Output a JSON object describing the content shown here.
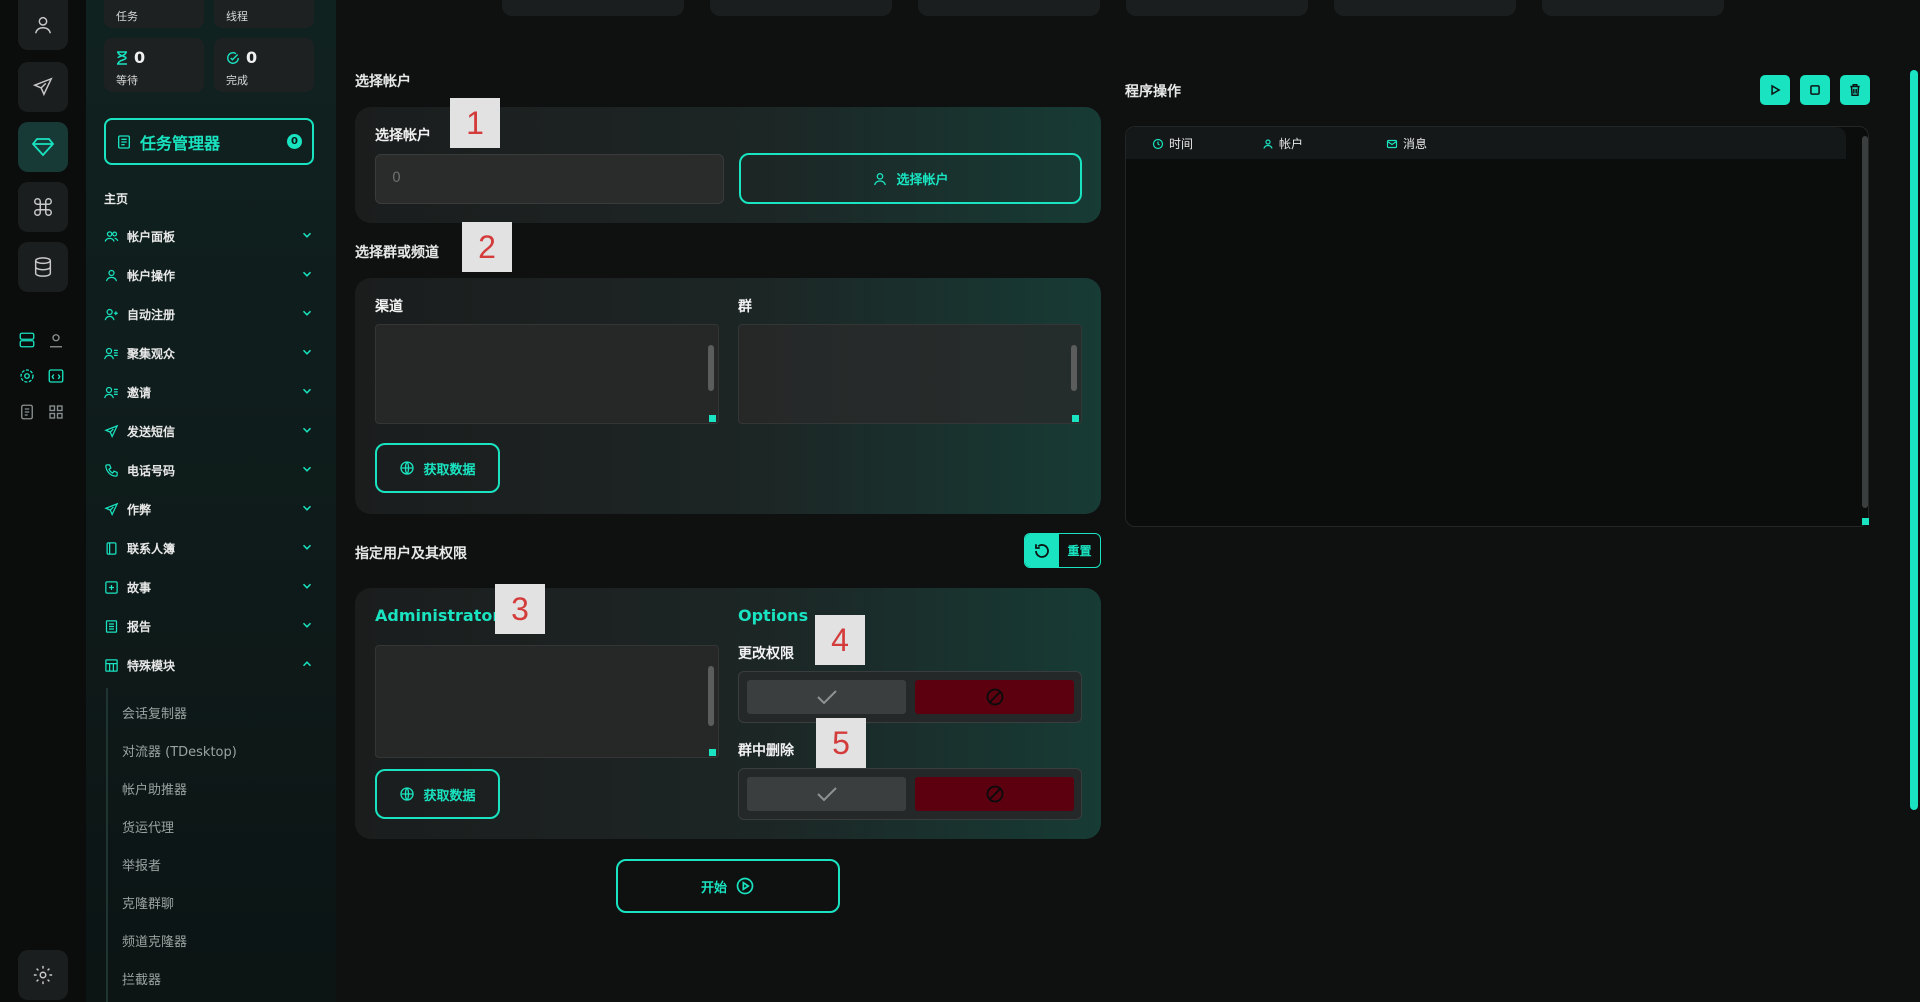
{
  "sidebar": {
    "stats": [
      {
        "label": "任务"
      },
      {
        "label": "线程"
      },
      {
        "value": "0",
        "label": "等待",
        "icon": "hourglass-icon"
      },
      {
        "value": "0",
        "label": "完成",
        "icon": "check-circle-icon"
      }
    ],
    "task_manager": {
      "label": "任务管理器",
      "badge": "0"
    },
    "section_label": "主页",
    "items": [
      {
        "label": "帐户面板",
        "icon": "users-icon"
      },
      {
        "label": "帐户操作",
        "icon": "user-icon"
      },
      {
        "label": "自动注册",
        "icon": "user-plus-icon"
      },
      {
        "label": "聚集观众",
        "icon": "user-list-icon"
      },
      {
        "label": "邀请",
        "icon": "user-list-icon"
      },
      {
        "label": "发送短信",
        "icon": "send-icon"
      },
      {
        "label": "电话号码",
        "icon": "phone-icon"
      },
      {
        "label": "作弊",
        "icon": "send-icon"
      },
      {
        "label": "联系人簿",
        "icon": "book-icon"
      },
      {
        "label": "故事",
        "icon": "plus-square-icon"
      },
      {
        "label": "报告",
        "icon": "report-icon"
      },
      {
        "label": "特殊模块",
        "icon": "table-icon"
      }
    ],
    "sub_items": [
      "会话复制器",
      "对流器 (TDesktop)",
      "帐户助推器",
      "货运代理",
      "举报者",
      "克隆群聊",
      "频道克隆器",
      "拦截器"
    ]
  },
  "main": {
    "select_account": {
      "section_title": "选择帐户",
      "field_label": "选择帐户",
      "input_value": "0",
      "button_label": "选择帐户",
      "callout": "1"
    },
    "select_group": {
      "section_title": "选择群或频道",
      "channel_label": "渠道",
      "group_label": "群",
      "button_label": "获取数据",
      "callout": "2"
    },
    "permissions": {
      "section_title": "指定用户及其权限",
      "reset_label": "重置",
      "admins_label": "Administrators",
      "admins_button": "获取数据",
      "options_label": "Options",
      "change_perm_label": "更改权限",
      "delete_label": "群中删除",
      "callouts": [
        "3",
        "4",
        "5"
      ]
    },
    "start_label": "开始"
  },
  "log": {
    "title": "程序操作",
    "columns": [
      {
        "label": "时间",
        "icon": "clock-icon"
      },
      {
        "label": "帐户",
        "icon": "user-icon"
      },
      {
        "label": "消息",
        "icon": "mail-icon"
      }
    ]
  },
  "colors": {
    "accent": "#19e3c0",
    "danger": "#5c0010",
    "bg": "#0f1111"
  }
}
